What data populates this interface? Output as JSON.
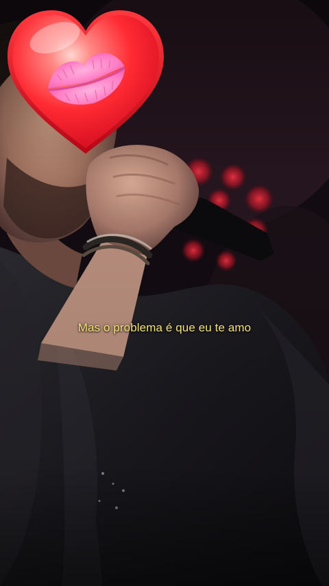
{
  "video": {
    "scene": "singer-with-microphone",
    "colors": {
      "background": "#0b0a0f",
      "stage_lights": "#ff2a3c",
      "skin": "#b98a73",
      "jacket": "#1d1c22"
    }
  },
  "caption": {
    "text": "Mas o problema é que eu te amo",
    "color": "#f4e27a"
  },
  "sticker": {
    "type": "heart-with-kiss",
    "heart_color": "#ff2a33",
    "lips_color": "#ff7fc6"
  }
}
